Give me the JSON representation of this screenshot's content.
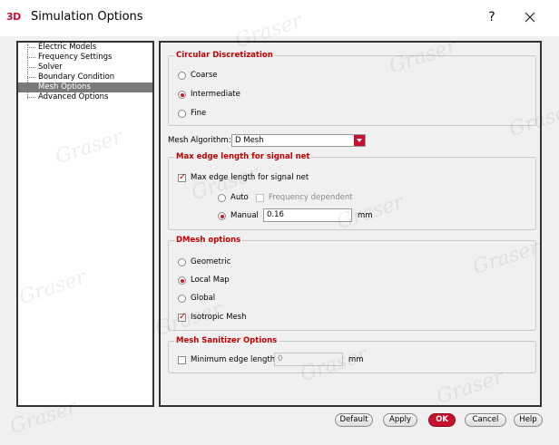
{
  "window": {
    "app_icon_text": "3D",
    "title": "Simulation Options",
    "help_label": "?"
  },
  "tree": {
    "items": [
      {
        "label": "Electric Models",
        "selected": false
      },
      {
        "label": "Frequency Settings",
        "selected": false
      },
      {
        "label": "Solver",
        "selected": false
      },
      {
        "label": "Boundary Condition",
        "selected": false
      },
      {
        "label": "Mesh Options",
        "selected": true
      },
      {
        "label": "Advanced Options",
        "selected": false
      }
    ]
  },
  "circular": {
    "title": "Circular Discretization",
    "options": [
      "Coarse",
      "Intermediate",
      "Fine"
    ],
    "selected": "Intermediate"
  },
  "mesh_algorithm": {
    "label": "Mesh Algorithm:",
    "value": "D Mesh"
  },
  "max_edge": {
    "title": "Max edge length for signal net",
    "checkbox_label": "Max edge length for signal net",
    "checked": true,
    "auto_label": "Auto",
    "freq_dep_label": "Frequency dependent",
    "manual_label": "Manual",
    "manual_value": "0.16",
    "unit": "mm"
  },
  "dmesh": {
    "title": "DMesh options",
    "options": [
      "Geometric",
      "Local Map",
      "Global"
    ],
    "selected": "Local Map",
    "isotropic_label": "Isotropic Mesh",
    "isotropic_checked": true
  },
  "sanitizer": {
    "title": "Mesh Sanitizer Options",
    "min_edge_label": "Minimum edge length",
    "min_edge_value": "0",
    "unit": "mm"
  },
  "buttons": {
    "default": "Default",
    "apply": "Apply",
    "ok": "OK",
    "cancel": "Cancel",
    "help": "Help"
  },
  "watermark_text": "Graser",
  "colors": {
    "accent": "#c8102e",
    "group_title": "#c00000",
    "selected_tree": "#7a7a7a"
  }
}
